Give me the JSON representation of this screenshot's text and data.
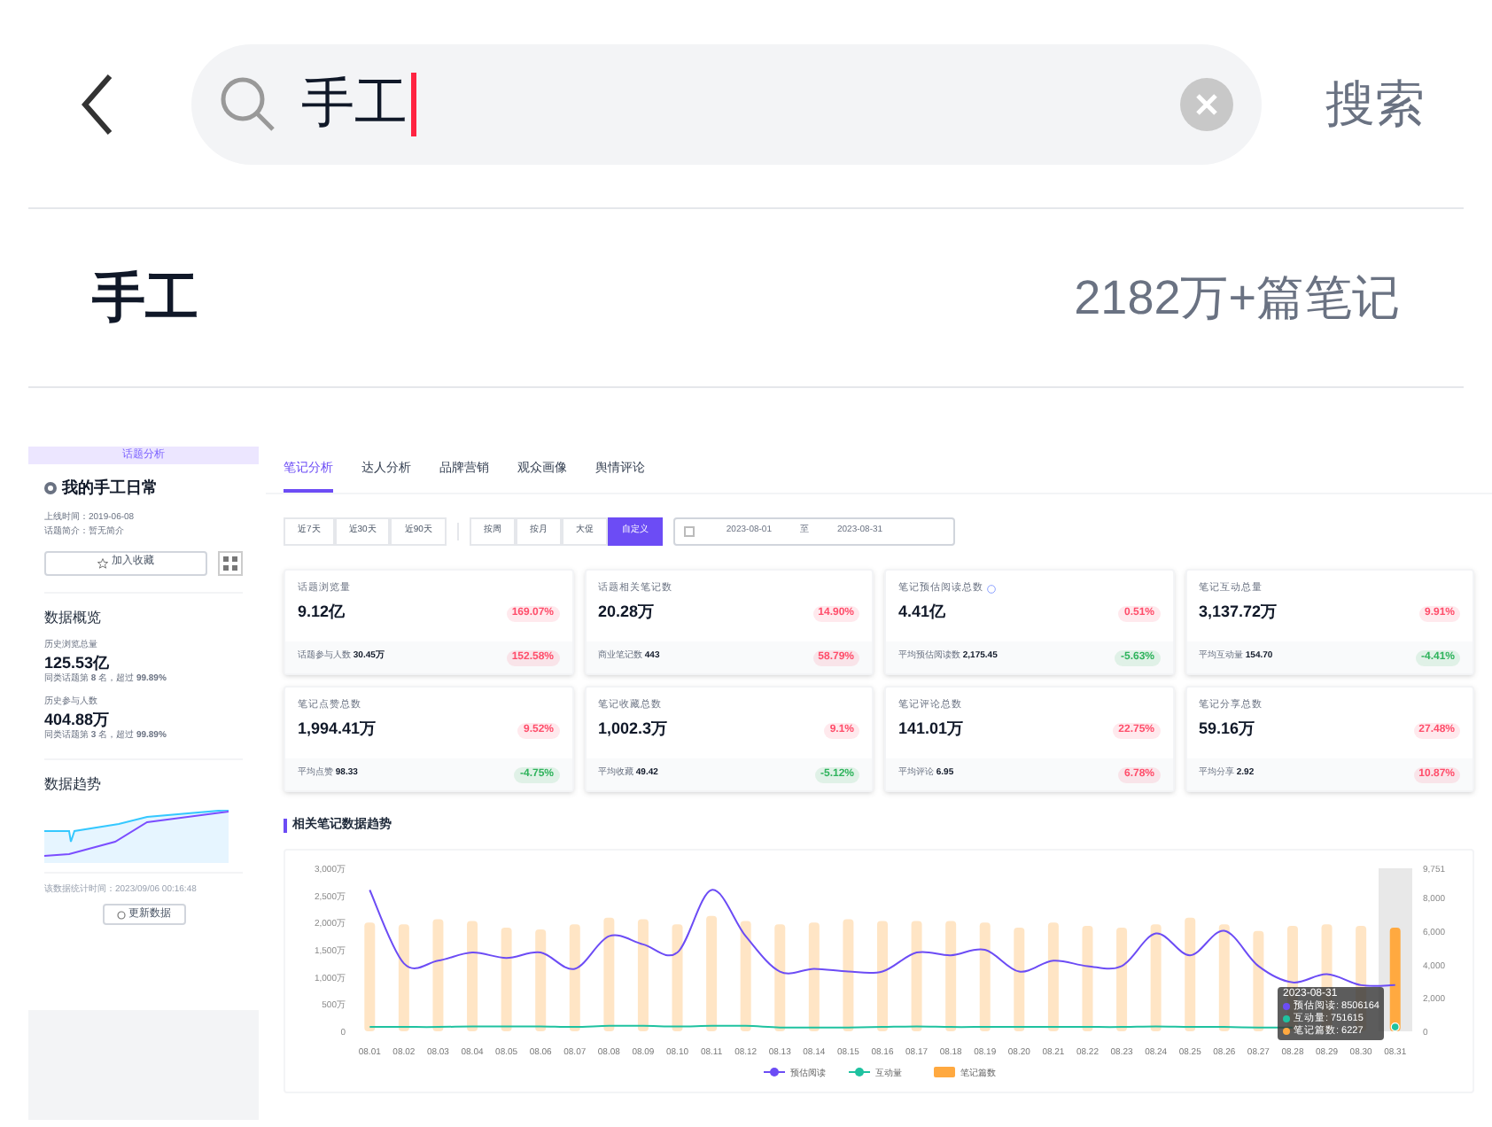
{
  "search": {
    "value": "手工",
    "action": "搜索"
  },
  "result": {
    "keyword": "手工",
    "count": "2182万+篇笔记"
  },
  "embedded": {
    "sidebar": {
      "header": "话题分析",
      "title": "我的手工日常",
      "meta": [
        "上线时间：2019-06-08",
        "话题简介：暂无简介"
      ],
      "favorite": "加入收藏",
      "overview_title": "数据概览",
      "stats": [
        {
          "label": "历史浏览总量",
          "value": "125.53亿",
          "rank": "同类话题第 **8** 名，超过 **99.89%**"
        },
        {
          "label": "历史参与人数",
          "value": "404.88万",
          "rank": "同类话题第 **3** 名，超过 **99.89%**"
        }
      ],
      "trend_title": "数据趋势",
      "updated": "该数据统计时间：2023/09/06 00:16:48",
      "refresh": "更新数据"
    },
    "tabs": [
      {
        "label": "笔记分析",
        "selected": true
      },
      {
        "label": "达人分析",
        "selected": false
      },
      {
        "label": "品牌营销",
        "selected": false
      },
      {
        "label": "观众画像",
        "selected": false
      },
      {
        "label": "舆情评论",
        "selected": false
      }
    ],
    "ranges": [
      {
        "label": "近7天",
        "selected": false
      },
      {
        "label": "近30天",
        "selected": false
      },
      {
        "label": "近90天",
        "selected": false
      }
    ],
    "periods": [
      {
        "label": "按周",
        "selected": false
      },
      {
        "label": "按月",
        "selected": false
      },
      {
        "label": "大促",
        "selected": false
      },
      {
        "label": "自定义",
        "selected": true
      }
    ],
    "date_range": {
      "start": "2023-08-01",
      "separator": "至",
      "end": "2023-08-31"
    },
    "cards": [
      {
        "title": "话题浏览量",
        "value": "9.12亿",
        "change": {
          "text": "169.07%",
          "color": "#ff4d6a"
        },
        "sub_label": "话题参与人数",
        "sub_value": "30.45万",
        "sub_change": {
          "text": "152.58%",
          "color": "#ff4d6a"
        }
      },
      {
        "title": "话题相关笔记数",
        "value": "20.28万",
        "change": {
          "text": "14.90%",
          "color": "#ff4d6a"
        },
        "sub_label": "商业笔记数",
        "sub_value": "443",
        "sub_change": {
          "text": "58.79%",
          "color": "#ff4d6a"
        }
      },
      {
        "title": "笔记预估阅读总数",
        "info": true,
        "value": "4.41亿",
        "change": {
          "text": "0.51%",
          "color": "#ff4d6a"
        },
        "sub_label": "平均预估阅读数",
        "sub_value": "2,175.45",
        "sub_change": {
          "text": "-5.63%",
          "color": "#2fb35c"
        }
      },
      {
        "title": "笔记互动总量",
        "value": "3,137.72万",
        "change": {
          "text": "9.91%",
          "color": "#ff4d6a"
        },
        "sub_label": "平均互动量",
        "sub_value": "154.70",
        "sub_change": {
          "text": "-4.41%",
          "color": "#2fb35c"
        }
      },
      {
        "title": "笔记点赞总数",
        "value": "1,994.41万",
        "change": {
          "text": "9.52%",
          "color": "#ff4d6a"
        },
        "sub_label": "平均点赞",
        "sub_value": "98.33",
        "sub_change": {
          "text": "-4.75%",
          "color": "#2fb35c"
        }
      },
      {
        "title": "笔记收藏总数",
        "value": "1,002.3万",
        "change": {
          "text": "9.1%",
          "color": "#ff4d6a"
        },
        "sub_label": "平均收藏",
        "sub_value": "49.42",
        "sub_change": {
          "text": "-5.12%",
          "color": "#2fb35c"
        }
      },
      {
        "title": "笔记评论总数",
        "value": "141.01万",
        "change": {
          "text": "22.75%",
          "color": "#ff4d6a"
        },
        "sub_label": "平均评论",
        "sub_value": "6.95",
        "sub_change": {
          "text": "6.78%",
          "color": "#ff4d6a"
        }
      },
      {
        "title": "笔记分享总数",
        "value": "59.16万",
        "change": {
          "text": "27.48%",
          "color": "#ff4d6a"
        },
        "sub_label": "平均分享",
        "sub_value": "2.92",
        "sub_change": {
          "text": "10.87%",
          "color": "#ff4d6a"
        }
      }
    ],
    "chart_title": "相关笔记数据趋势",
    "chart": {
      "chart_data": {
        "type": "bar",
        "categories": [
          "08.01",
          "08.02",
          "08.03",
          "08.04",
          "08.05",
          "08.06",
          "08.07",
          "08.08",
          "08.09",
          "08.10",
          "08.11",
          "08.12",
          "08.13",
          "08.14",
          "08.15",
          "08.16",
          "08.17",
          "08.18",
          "08.19",
          "08.20",
          "08.21",
          "08.22",
          "08.23",
          "08.24",
          "08.25",
          "08.26",
          "08.27",
          "08.28",
          "08.29",
          "08.30",
          "08.31"
        ],
        "ylim": [
          0,
          3000
        ],
        "yticks": [
          {
            "value": 0,
            "label": "0"
          },
          {
            "value": 500,
            "label": "500万"
          },
          {
            "value": 1000,
            "label": "1,000万"
          },
          {
            "value": 1500,
            "label": "1,500万"
          },
          {
            "value": 2000,
            "label": "2,000万"
          },
          {
            "value": 2500,
            "label": "2,500万"
          },
          {
            "value": 3000,
            "label": "3,000万"
          }
        ],
        "y2lim": [
          0,
          9751
        ],
        "y2ticks": [
          {
            "value": 0,
            "label": "0"
          },
          {
            "value": 2000,
            "label": "2,000"
          },
          {
            "value": 4000,
            "label": "4,000"
          },
          {
            "value": 6000,
            "label": "6,000"
          },
          {
            "value": 8000,
            "label": "8,000"
          },
          {
            "value": 9751,
            "label": "9,751"
          }
        ],
        "stacked": false,
        "legend": "bottom",
        "series": [
          {
            "name": "预估阅读",
            "type": "line",
            "color": "#6c4cf5",
            "values": [
              2600,
              1250,
              1300,
              1450,
              1350,
              1450,
              1150,
              1750,
              1600,
              1450,
              2600,
              1750,
              1100,
              1150,
              1100,
              1100,
              1450,
              1400,
              1500,
              1100,
              1300,
              1200,
              1200,
              1800,
              1400,
              1850,
              1200,
              900,
              1050,
              850,
              850
            ]
          },
          {
            "name": "互动量",
            "type": "line",
            "color": "#1fc2a0",
            "values": [
              80,
              80,
              80,
              90,
              90,
              90,
              80,
              100,
              100,
              90,
              100,
              100,
              70,
              70,
              70,
              80,
              90,
              80,
              80,
              80,
              80,
              80,
              80,
              90,
              80,
              80,
              70,
              70,
              null,
              null,
              80
            ]
          },
          {
            "name": "笔记篇数",
            "type": "bar",
            "axis": "y2",
            "color": "#ffa940",
            "values": [
              6500,
              6400,
              6700,
              6600,
              6200,
              6100,
              6400,
              6800,
              6700,
              6400,
              6900,
              6600,
              6400,
              6500,
              6700,
              6600,
              6600,
              6600,
              6500,
              6200,
              6500,
              6300,
              6200,
              6400,
              6800,
              6400,
              6000,
              6300,
              6400,
              6300,
              6200
            ]
          }
        ]
      },
      "tooltip": {
        "title": "2023-08-31",
        "lines": [
          "预估阅读: 8506164",
          "互动量: 751615",
          "笔记篇数: 6227"
        ]
      }
    }
  }
}
